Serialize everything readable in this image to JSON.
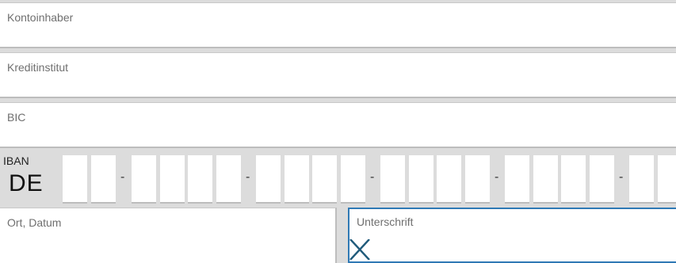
{
  "fields": {
    "kontoinhaber_label": "Kontoinhaber",
    "kreditinstitut_label": "Kreditinstitut",
    "bic_label": "BIC",
    "ort_datum_label": "Ort, Datum",
    "unterschrift_label": "Unterschrift"
  },
  "iban": {
    "label": "IBAN",
    "country": "DE",
    "separator": "-"
  },
  "signature": {
    "mark": "X"
  },
  "colors": {
    "background": "#dcdcdc",
    "field": "#ffffff",
    "label": "#6f6f6f",
    "active_border": "#2f79b5",
    "signature_x": "#1f5a7a"
  }
}
